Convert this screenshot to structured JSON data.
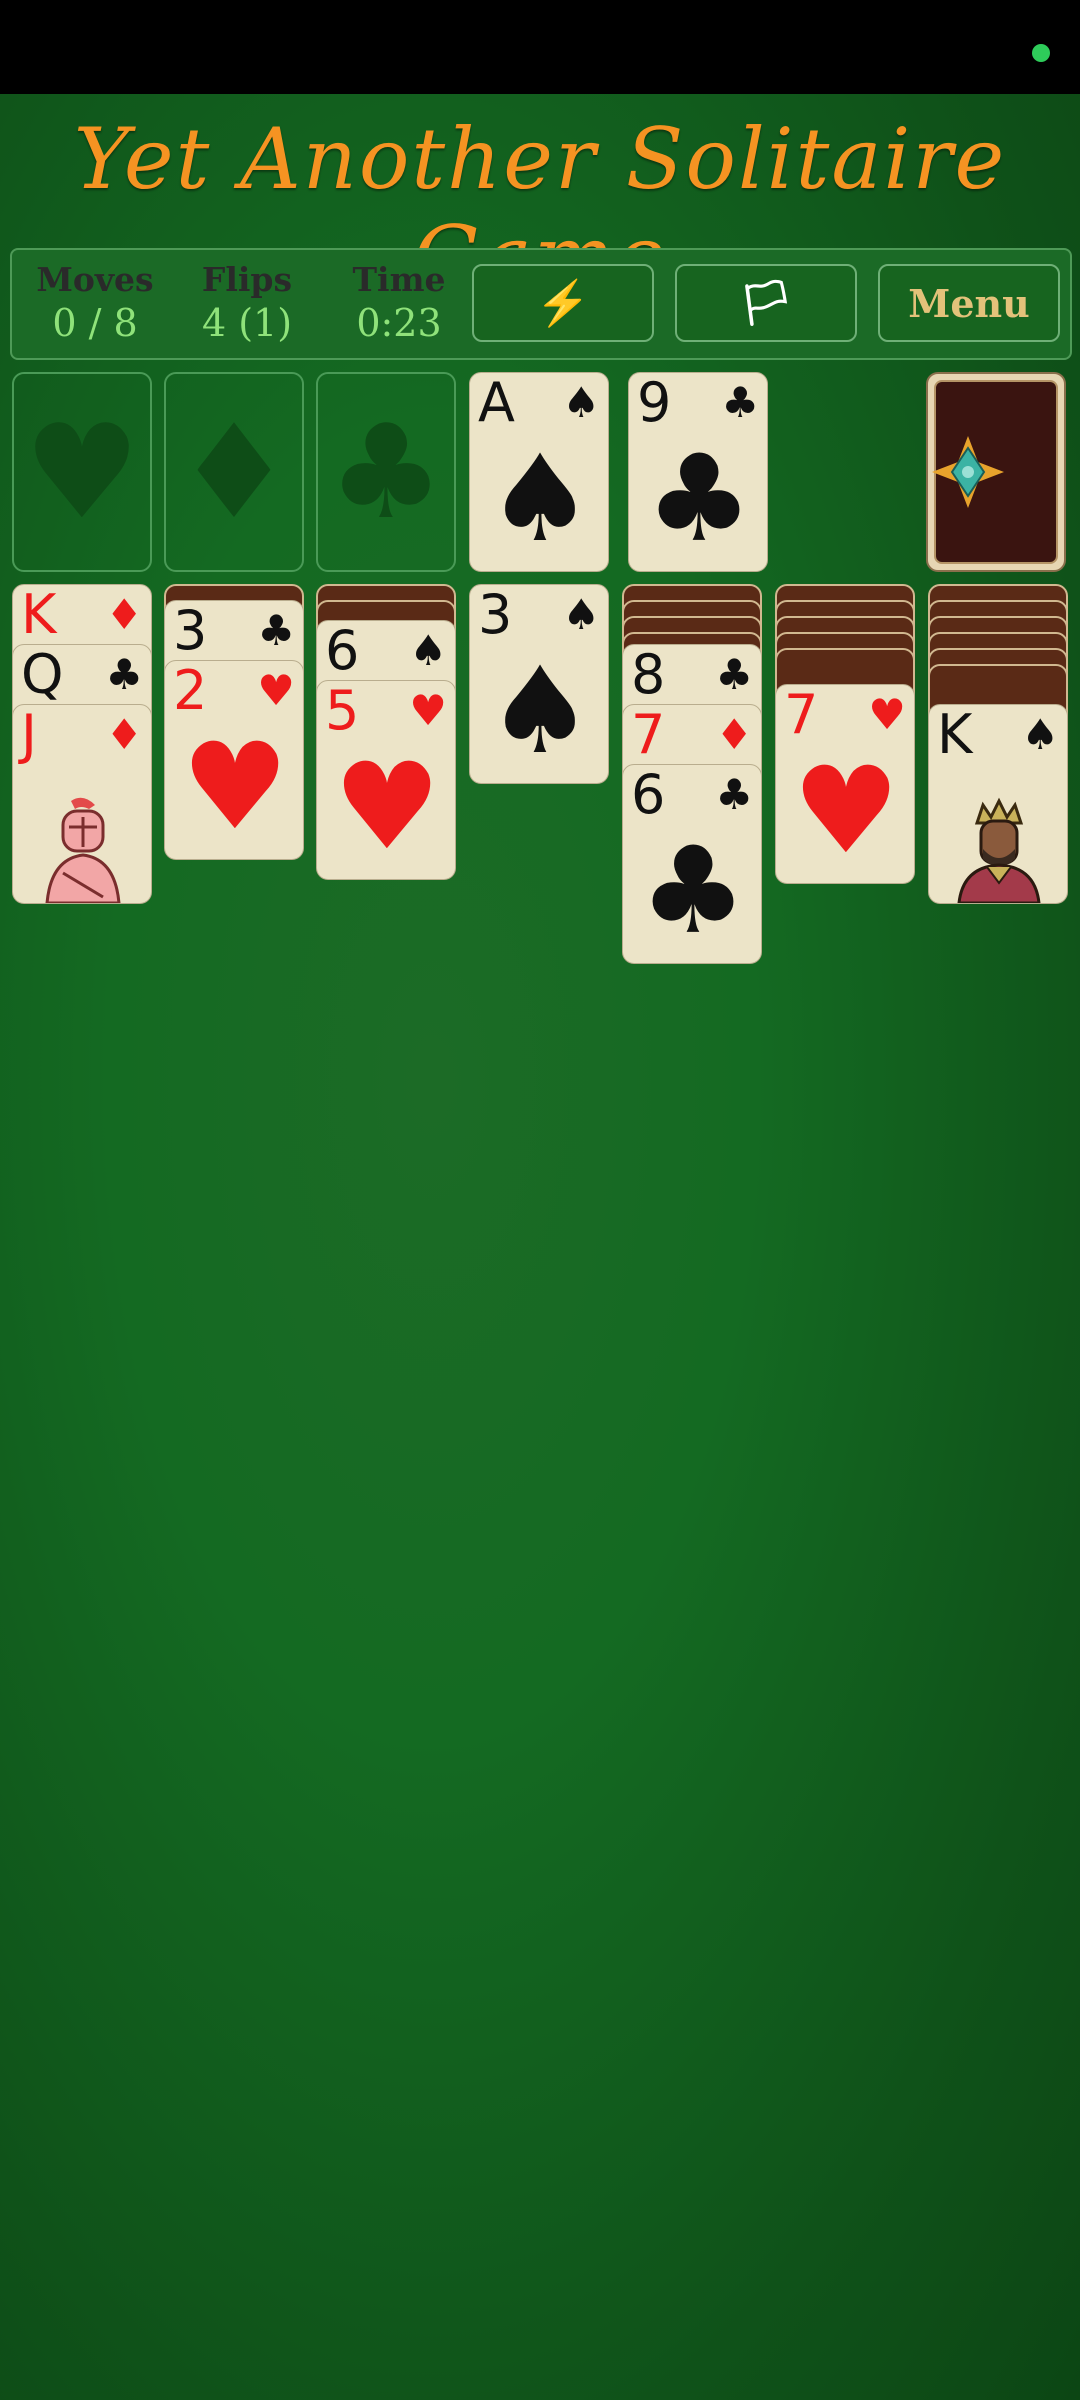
{
  "title": "Yet Another Solitaire Game",
  "stats": {
    "moves_label": "Moves",
    "moves_value": "0 / 8",
    "flips_label": "Flips",
    "flips_value": "4 (1)",
    "time_label": "Time",
    "time_value": "0:23"
  },
  "buttons": {
    "hint_icon": "⚡",
    "flag_icon": "🏳",
    "menu_label": "Menu"
  },
  "foundations": [
    "♥",
    "♦",
    "♣"
  ],
  "waste": [
    {
      "rank": "A",
      "suit": "♠",
      "color": "black"
    },
    {
      "rank": "9",
      "suit": "♣",
      "color": "black"
    }
  ],
  "tableau": [
    {
      "face_down": 0,
      "cards": [
        {
          "rank": "K",
          "suit": "♦",
          "color": "red"
        },
        {
          "rank": "Q",
          "suit": "♣",
          "color": "black"
        },
        {
          "rank": "J",
          "suit": "♦",
          "color": "red",
          "face": "knight"
        }
      ]
    },
    {
      "face_down": 1,
      "cards": [
        {
          "rank": "3",
          "suit": "♣",
          "color": "black"
        },
        {
          "rank": "2",
          "suit": "♥",
          "color": "red"
        }
      ]
    },
    {
      "face_down": 2,
      "cards": [
        {
          "rank": "6",
          "suit": "♠",
          "color": "black"
        },
        {
          "rank": "5",
          "suit": "♥",
          "color": "red"
        }
      ]
    },
    {
      "face_down": 0,
      "cards": [
        {
          "rank": "3",
          "suit": "♠",
          "color": "black"
        }
      ]
    },
    {
      "face_down": 4,
      "cards": [
        {
          "rank": "8",
          "suit": "♣",
          "color": "black"
        },
        {
          "rank": "7",
          "suit": "♦",
          "color": "red"
        },
        {
          "rank": "6",
          "suit": "♣",
          "color": "black"
        }
      ]
    },
    {
      "face_down": 5,
      "cards": [
        {
          "rank": "7",
          "suit": "♥",
          "color": "red"
        }
      ]
    },
    {
      "face_down": 6,
      "cards": [
        {
          "rank": "K",
          "suit": "♠",
          "color": "black",
          "face": "king"
        }
      ]
    }
  ],
  "colors": {
    "title": "#f59322",
    "stat_value": "#8fe27a",
    "felt": "#146a22",
    "red_suit": "#ee1c1c"
  }
}
